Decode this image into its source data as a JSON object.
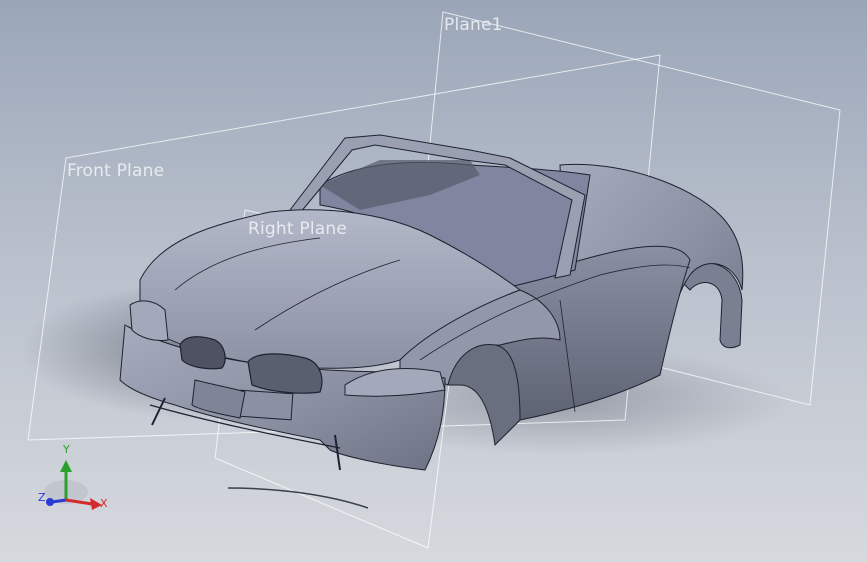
{
  "planes": {
    "plane1": "Plane1",
    "front": "Front Plane",
    "right": "Right Plane"
  },
  "triad": {
    "x": "X",
    "y": "Y",
    "z": "Z"
  },
  "colors": {
    "body": "#8e93a6",
    "edges": "#1e2230",
    "plane_outline": "#ffffff",
    "x_axis": "#d42a2a",
    "y_axis": "#2aa12a",
    "z_axis": "#2a3ad4"
  },
  "icons": {
    "triad": "reference-triad-icon"
  }
}
